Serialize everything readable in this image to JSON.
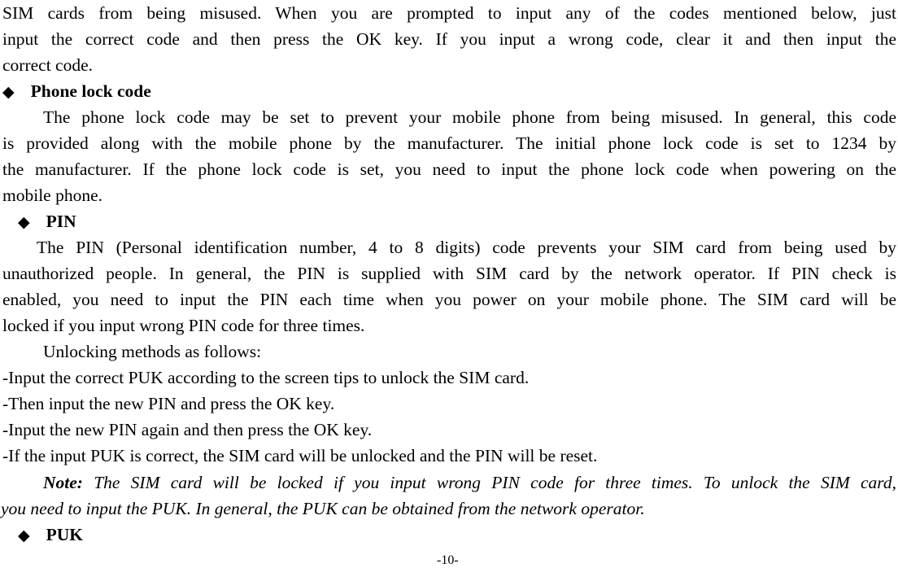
{
  "intro": {
    "lines": [
      "SIM cards from being misused. When you are prompted to input any of the codes mentioned below, just",
      "input the correct code and then press the OK key. If you input a wrong code, clear it and then input the",
      "correct code."
    ]
  },
  "sections": [
    {
      "heading": "Phone lock code",
      "bullet_icon": "◆",
      "lines": [
        "The phone lock code may be set to prevent your mobile phone from being misused. In general, this code",
        "is provided along with the mobile phone by the manufacturer. The initial phone lock code is set to 1234 by",
        "the manufacturer. If the phone lock code is set, you need to input the phone lock code when powering on the",
        "mobile phone."
      ]
    },
    {
      "heading": "PIN",
      "bullet_icon": "◆",
      "lines": [
        "The PIN (Personal identification number, 4 to 8 digits) code prevents your SIM card from being used by",
        "unauthorized people. In general, the PIN is supplied with SIM card by the network operator. If PIN check is",
        "enabled, you need to input the PIN each time when you power on your mobile phone. The SIM card will be",
        "locked if you input wrong PIN code for three times."
      ],
      "unlock_intro": "Unlocking methods as follows:",
      "steps": [
        "-Input the correct PUK according to the screen tips to unlock the SIM card.",
        "-Then input the new PIN and press the OK key.",
        "-Input the new PIN again and then press the OK key.",
        "-If the input PUK is correct, the SIM card will be unlocked and the PIN will be reset."
      ],
      "note_label": "Note:",
      "note_lines": [
        " The SIM card will be locked if you input wrong PIN code for three times. To unlock the SIM card,",
        "you need to input the PUK. In general, the PUK can be obtained from the network operator."
      ]
    },
    {
      "heading": "PUK",
      "bullet_icon": "◆"
    }
  ],
  "page_number": "-10-"
}
